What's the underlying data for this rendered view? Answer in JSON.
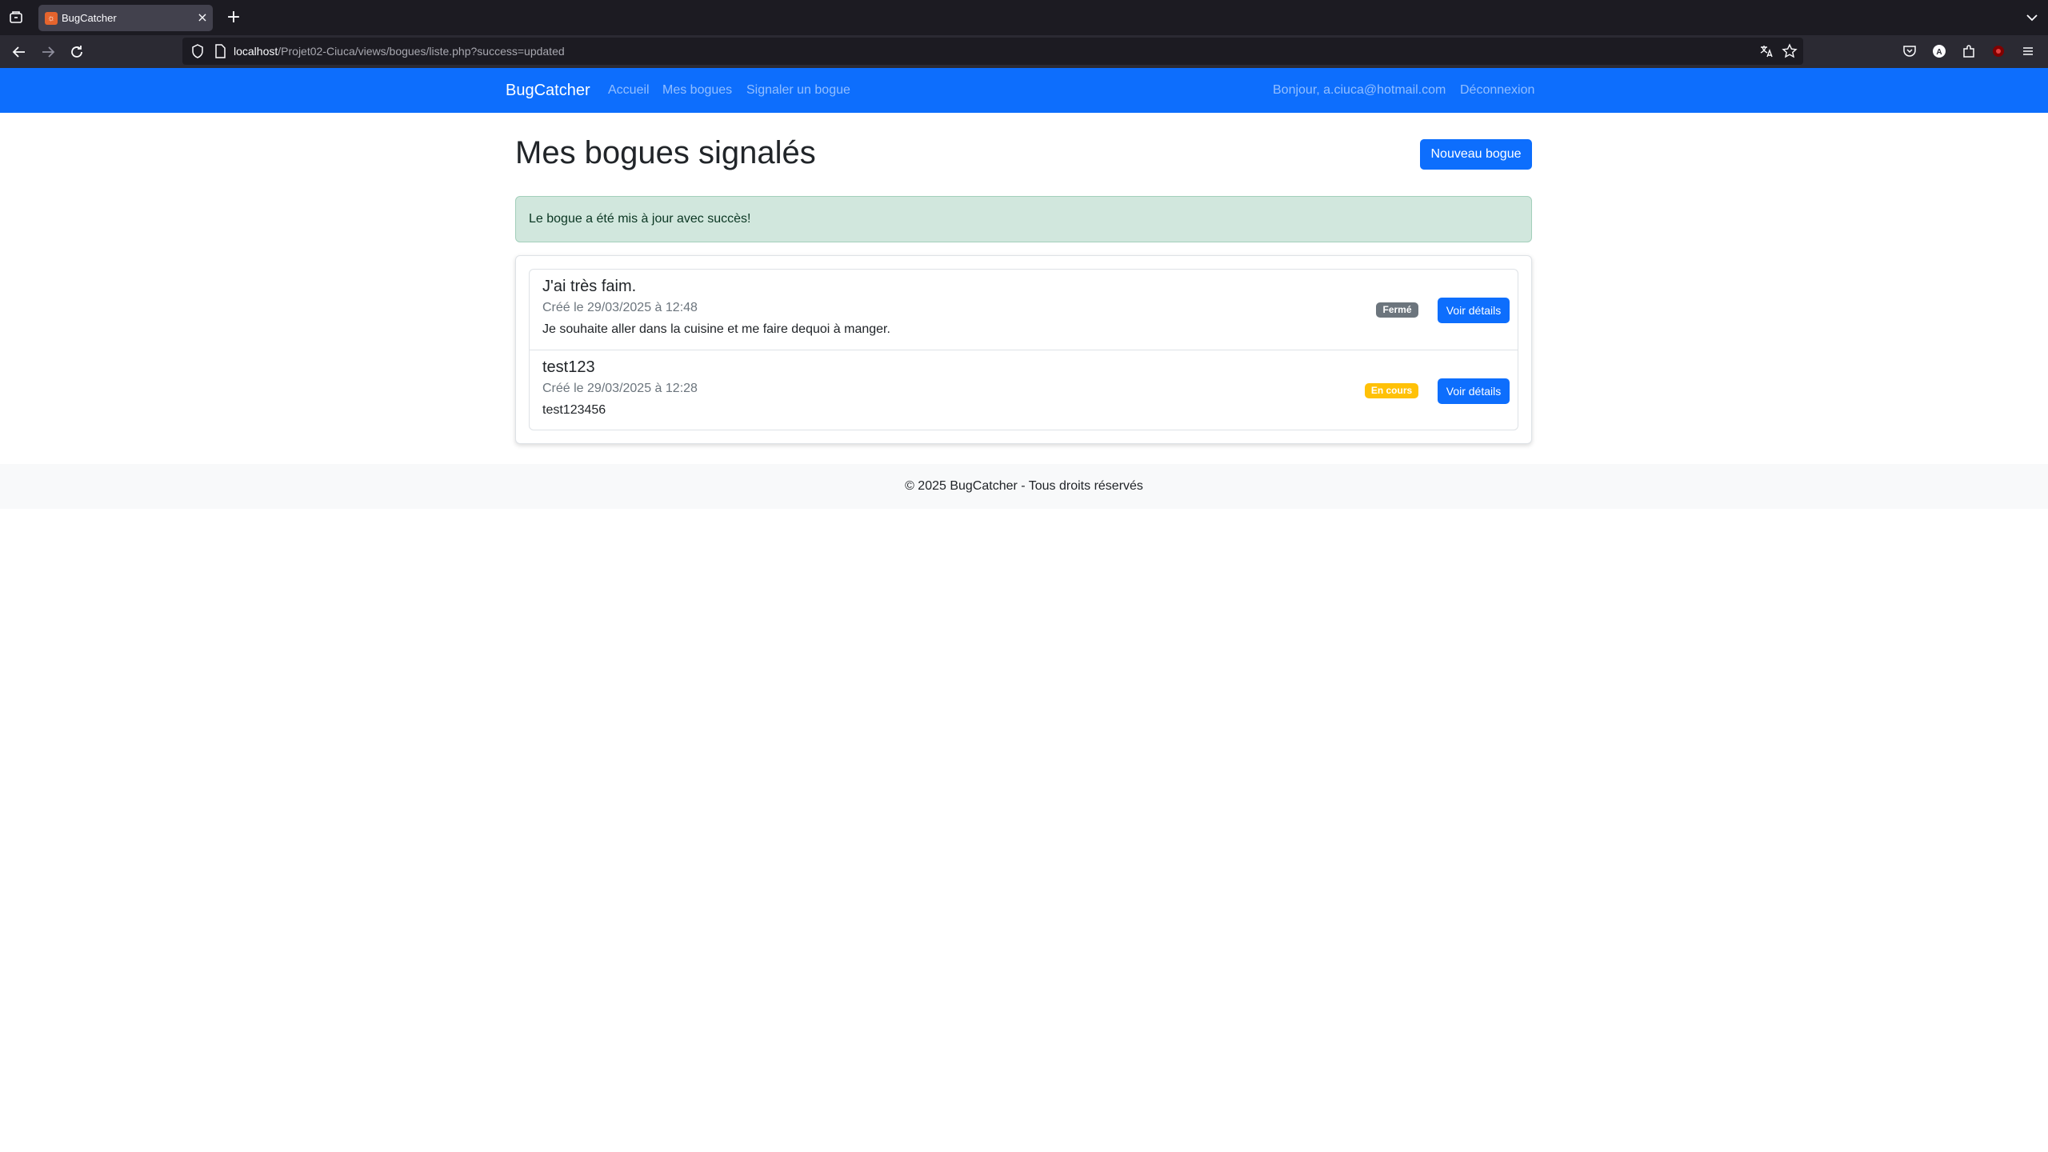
{
  "browser": {
    "tab_title": "BugCatcher",
    "favicon_icon": "bug-icon",
    "url_host": "localhost",
    "url_path": "/Projet02-Ciuca/views/bogues/liste.php?success=updated"
  },
  "site": {
    "brand": "BugCatcher",
    "nav_links": [
      "Accueil",
      "Mes bogues",
      "Signaler un bogue"
    ],
    "user_greeting": "Bonjour, a.ciuca@hotmail.com",
    "logout": "Déconnexion",
    "accent_color": "#0d6efd"
  },
  "page": {
    "title": "Mes bogues signalés",
    "new_button": "Nouveau bogue",
    "alert": "Le bogue a été mis à jour avec succès!"
  },
  "bugs": [
    {
      "title": "J'ai très faim.",
      "created": "Créé le 29/03/2025 à 12:48",
      "description": "Je souhaite aller dans la cuisine et me faire dequoi à manger.",
      "status": "Fermé",
      "status_color": "#6c757d",
      "action": "Voir détails"
    },
    {
      "title": "test123",
      "created": "Créé le 29/03/2025 à 12:28",
      "description": "test123456",
      "status": "En cours",
      "status_color": "#ffc107",
      "action": "Voir détails"
    }
  ],
  "footer": {
    "text": "© 2025 BugCatcher - Tous droits réservés"
  }
}
